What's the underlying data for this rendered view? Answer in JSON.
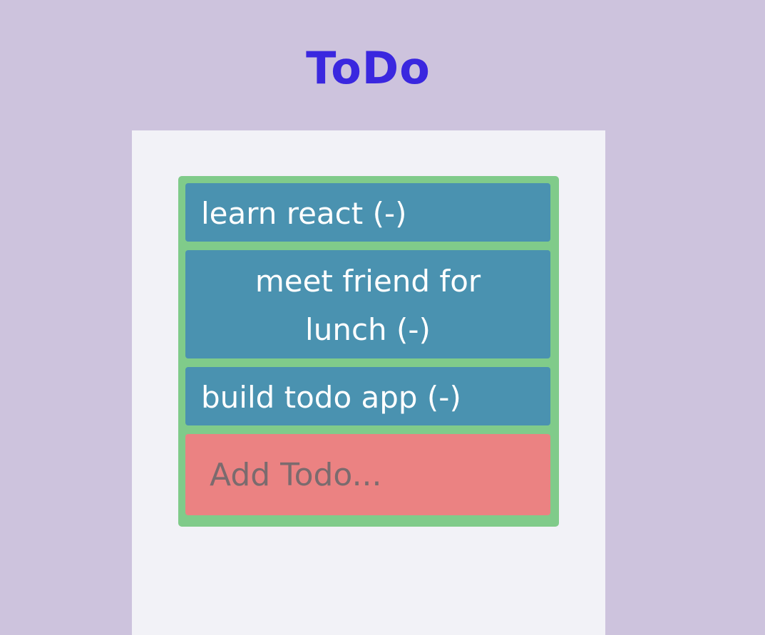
{
  "header": {
    "title": "ToDo"
  },
  "todos": [
    {
      "label": "learn react (-)"
    },
    {
      "label": "meet friend for lunch (-)"
    },
    {
      "label": "build todo app (-)"
    }
  ],
  "add_todo": {
    "placeholder": "Add Todo...",
    "value": ""
  },
  "colors": {
    "background": "#cdc3dd",
    "title": "#3a27df",
    "panel": "#f2f2f7",
    "list_bg": "#80cb8a",
    "item_bg": "#4a92b0",
    "input_bg": "#eb8282"
  }
}
